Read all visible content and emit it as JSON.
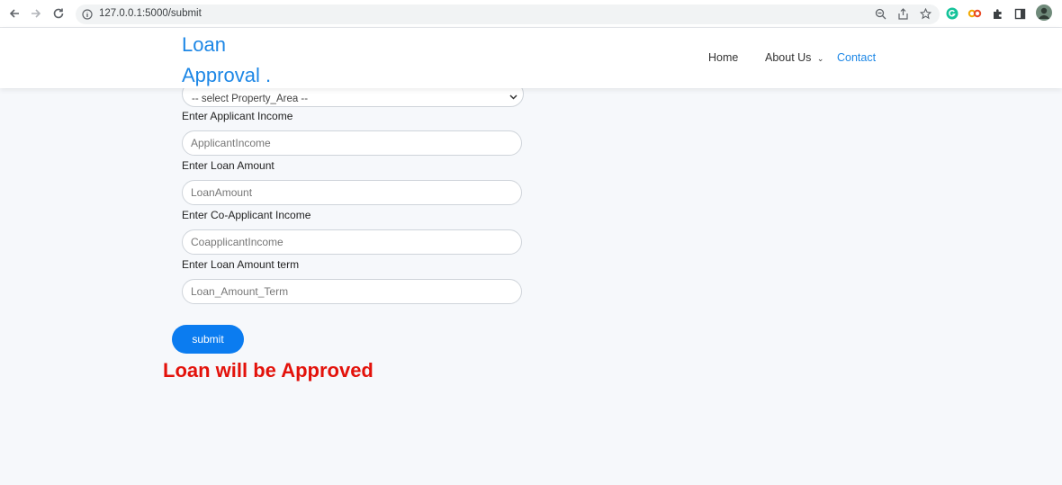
{
  "browser": {
    "url": "127.0.0.1:5000/submit"
  },
  "navbar": {
    "brand_line1": "Loan",
    "brand_line2": "Approval .",
    "links": [
      {
        "label": "Home"
      },
      {
        "label": "About Us"
      },
      {
        "label": "Contact"
      }
    ]
  },
  "form": {
    "property_area_select": "-- select Property_Area --",
    "fields": [
      {
        "label": "Enter Applicant Income",
        "placeholder": "ApplicantIncome"
      },
      {
        "label": "Enter Loan Amount",
        "placeholder": "LoanAmount"
      },
      {
        "label": "Enter Co-Applicant Income",
        "placeholder": "CoapplicantIncome"
      },
      {
        "label": "Enter Loan Amount term",
        "placeholder": "Loan_Amount_Term"
      }
    ],
    "submit_label": "submit"
  },
  "result": {
    "text": "Loan will be Approved",
    "color": "#e3120b"
  },
  "colors": {
    "accent": "#1d87e6",
    "button": "#0b7cf0"
  }
}
